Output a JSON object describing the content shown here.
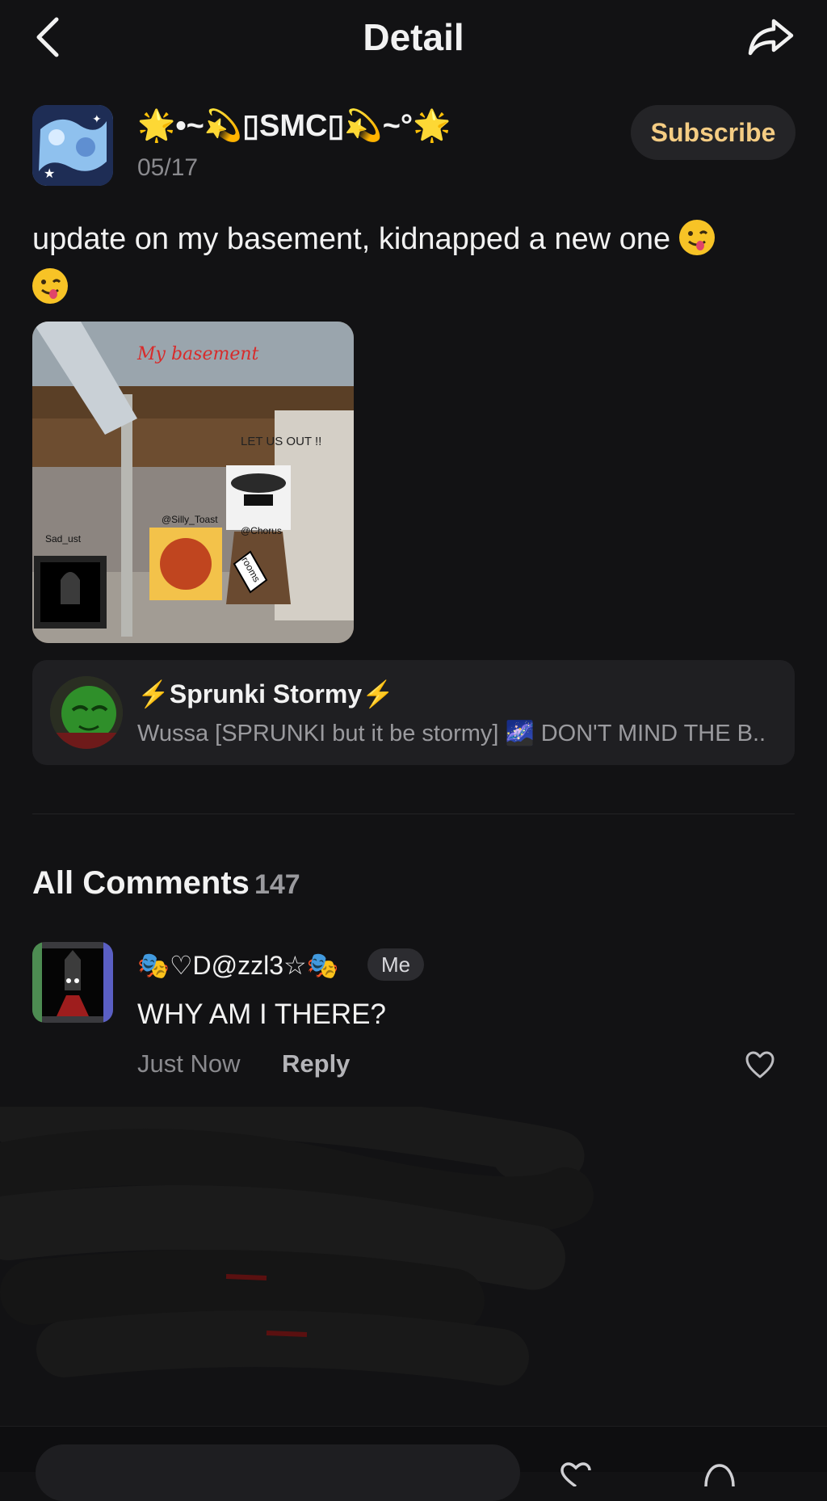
{
  "header": {
    "title": "Detail",
    "back_icon": "chevron-left-icon",
    "share_icon": "share-arrow-icon"
  },
  "post": {
    "author": {
      "name": "🌟•~💫▯SMC▯💫~°🌟",
      "avatar_icon": "author-avatar"
    },
    "date": "05/17",
    "subscribe_label": "Subscribe",
    "text": "update on my basement, kidnapped a new one",
    "image": {
      "caption": "My basement",
      "stickers": [
        "LET US OUT !!",
        "@Silly_Toast",
        "@Chorus",
        "Sad_ust",
        "rooms"
      ]
    },
    "linked_game": {
      "title": "Sprunki Stormy",
      "description": "Wussa [SPRUNKI but it be stormy] 🌌 DON'T MIND THE B..."
    }
  },
  "comments": {
    "heading": "All Comments",
    "count": "147",
    "items": [
      {
        "author": "🎭♡D@zzl3☆🎭",
        "badge": "Me",
        "text": "WHY AM I THERE?",
        "time": "Just Now",
        "reply_label": "Reply"
      }
    ]
  },
  "colors": {
    "background": "#121214",
    "accent_subscribe": "#f4cc83",
    "muted_text": "#8a8a8e",
    "card": "#1f1f22"
  }
}
